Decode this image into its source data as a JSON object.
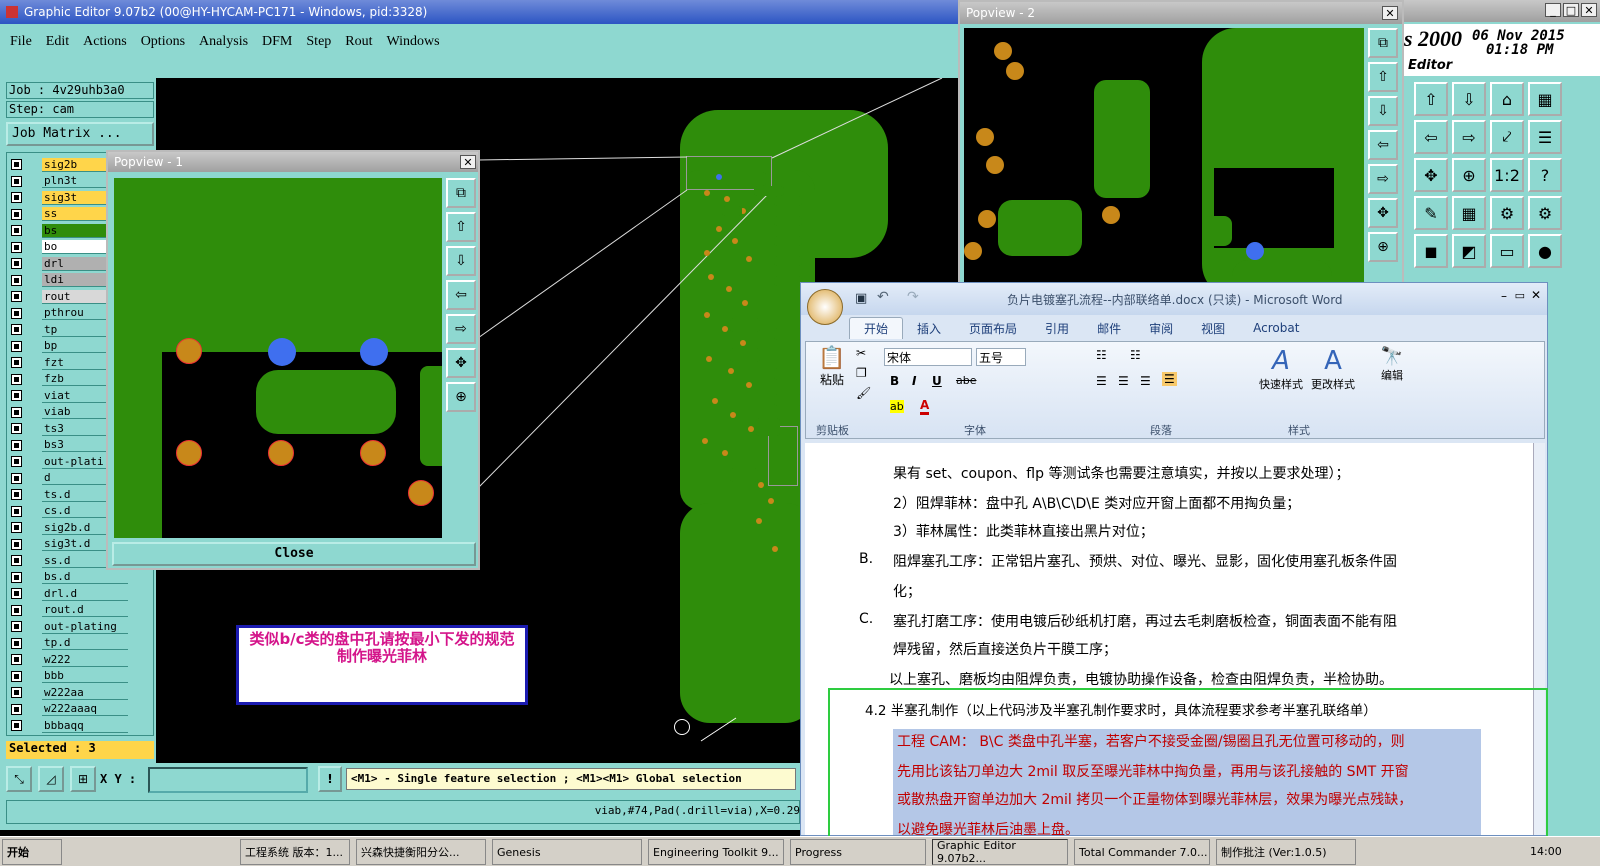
{
  "editor": {
    "title": "Graphic Editor 9.07b2 (00@HY-HYCAM-PC171 - Windows, pid:3328)",
    "menu": [
      "File",
      "Edit",
      "Actions",
      "Options",
      "Analysis",
      "DFM",
      "Step",
      "Rout",
      "Windows"
    ],
    "job": "Job : 4v29uhb3a0",
    "step": "Step: cam",
    "job_matrix": "Job Matrix ...",
    "selected": "Selected : 3",
    "xy_label": "X Y :",
    "hint": "<M1> - Single feature selection ; <M1><M1> Global selection",
    "status": "viab,#74,Pad(.drill=via),X=0.29"
  },
  "layers": [
    {
      "name": "sig2b",
      "color": "#ffd54a"
    },
    {
      "name": "pln3t",
      "color": "#8ed8d0"
    },
    {
      "name": "sig3t",
      "color": "#ffd54a"
    },
    {
      "name": "ss",
      "color": "#ffd54a"
    },
    {
      "name": "bs",
      "color": "#2f8d0b"
    },
    {
      "name": "bo",
      "color": "#ffffff"
    },
    {
      "name": "drl",
      "color": "#b0b0b0"
    },
    {
      "name": "ldi",
      "color": "#b0b0b0"
    },
    {
      "name": "rout",
      "color": "#d8d8d8"
    },
    {
      "name": "pthrou",
      "color": "#8ed8d0"
    },
    {
      "name": "tp",
      "color": "#8ed8d0"
    },
    {
      "name": "bp",
      "color": "#8ed8d0"
    },
    {
      "name": "fzt",
      "color": "#8ed8d0"
    },
    {
      "name": "fzb",
      "color": "#8ed8d0"
    },
    {
      "name": "viat",
      "color": "#8ed8d0"
    },
    {
      "name": "viab",
      "color": "#8ed8d0"
    },
    {
      "name": "ts3",
      "color": "#8ed8d0"
    },
    {
      "name": "bs3",
      "color": "#8ed8d0"
    },
    {
      "name": "out-plati",
      "color": "#8ed8d0"
    },
    {
      "name": "d",
      "color": "#8ed8d0"
    },
    {
      "name": "ts.d",
      "color": "#8ed8d0"
    },
    {
      "name": "cs.d",
      "color": "#8ed8d0"
    },
    {
      "name": "sig2b.d",
      "color": "#8ed8d0"
    },
    {
      "name": "sig3t.d",
      "color": "#8ed8d0"
    },
    {
      "name": "ss.d",
      "color": "#8ed8d0"
    },
    {
      "name": "bs.d",
      "color": "#8ed8d0"
    },
    {
      "name": "drl.d",
      "color": "#8ed8d0"
    },
    {
      "name": "rout.d",
      "color": "#8ed8d0"
    },
    {
      "name": "out-plating",
      "color": "#8ed8d0"
    },
    {
      "name": "tp.d",
      "color": "#8ed8d0"
    },
    {
      "name": "w222",
      "color": "#8ed8d0"
    },
    {
      "name": "bbb",
      "color": "#8ed8d0"
    },
    {
      "name": "w222aa",
      "color": "#8ed8d0"
    },
    {
      "name": "w222aaaq",
      "color": "#8ed8d0"
    },
    {
      "name": "bbbaqq",
      "color": "#8ed8d0"
    }
  ],
  "popview1": {
    "title": "Popview - 1",
    "close": "Close"
  },
  "popview2": {
    "title": "Popview - 2"
  },
  "annotation": "类似b/c类的盘中孔请按最小下发的规范制作曝光菲林",
  "right_panel": {
    "title_part": "s 2000",
    "date": "06 Nov 2015",
    "time": "01:18 PM",
    "sub": "Editor"
  },
  "word": {
    "title": "负片电镀塞孔流程--内部联络单.docx (只读) - Microsoft Word",
    "tabs": [
      "开始",
      "插入",
      "页面布局",
      "引用",
      "邮件",
      "审阅",
      "视图",
      "Acrobat"
    ],
    "font": "宋体",
    "size": "五号",
    "groups": [
      "剪贴板",
      "字体",
      "段落",
      "样式"
    ],
    "paste": "粘贴",
    "quick_style": "快速样式",
    "change_style": "更改样式",
    "edit": "编辑",
    "lines": [
      "果有 set、coupon、flp 等测试条也需要注意填实，并按以上要求处理）；",
      "2）阻焊菲林：盘中孔 A\\B\\C\\D\\E 类对应开窗上面都不用掏负量；",
      "3）菲林属性：此类菲林直接出黑片对位；",
      "阻焊塞孔工序：正常铝片塞孔、预烘、对位、曝光、显影，固化使用塞孔板条件固",
      "化；",
      "塞孔打磨工序：使用电镀后砂纸机打磨，再过去毛刺磨板检查，铜面表面不能有阻",
      "焊残留，然后直接送负片干膜工序；",
      "以上塞孔、磨板均由阻焊负责，电镀协助操作设备，检查由阻焊负责，半检协助。",
      "4.2  半塞孔制作（以上代码涉及半塞孔制作要求时，具体流程要求参考半塞孔联络单）",
      "工程 CAM： B\\C 类盘中孔半塞，若客户不接受金圈/锡圈且孔无位置可移动的，则",
      "先用比该钻刀单边大 2mil 取反至曝光菲林中掏负量，再用与该孔接触的 SMT 开窗",
      "或散热盘开窗单边加大 2mil 拷贝一个正量物体到曝光菲林层，效果为曝光点残缺，",
      "以避免曝光菲林后油墨上盘。"
    ],
    "markers": {
      "b": "B.",
      "c": "C."
    }
  },
  "taskbar": [
    "开始",
    "工程系统  版本：1...",
    "兴森快捷衡阳分公...",
    "Genesis",
    "Engineering Toolkit 9...",
    "Progress",
    "Graphic Editor 9.07b2...",
    "Total Commander 7.0...",
    "制作批注 (Ver:1.0.5)",
    "14:00"
  ]
}
